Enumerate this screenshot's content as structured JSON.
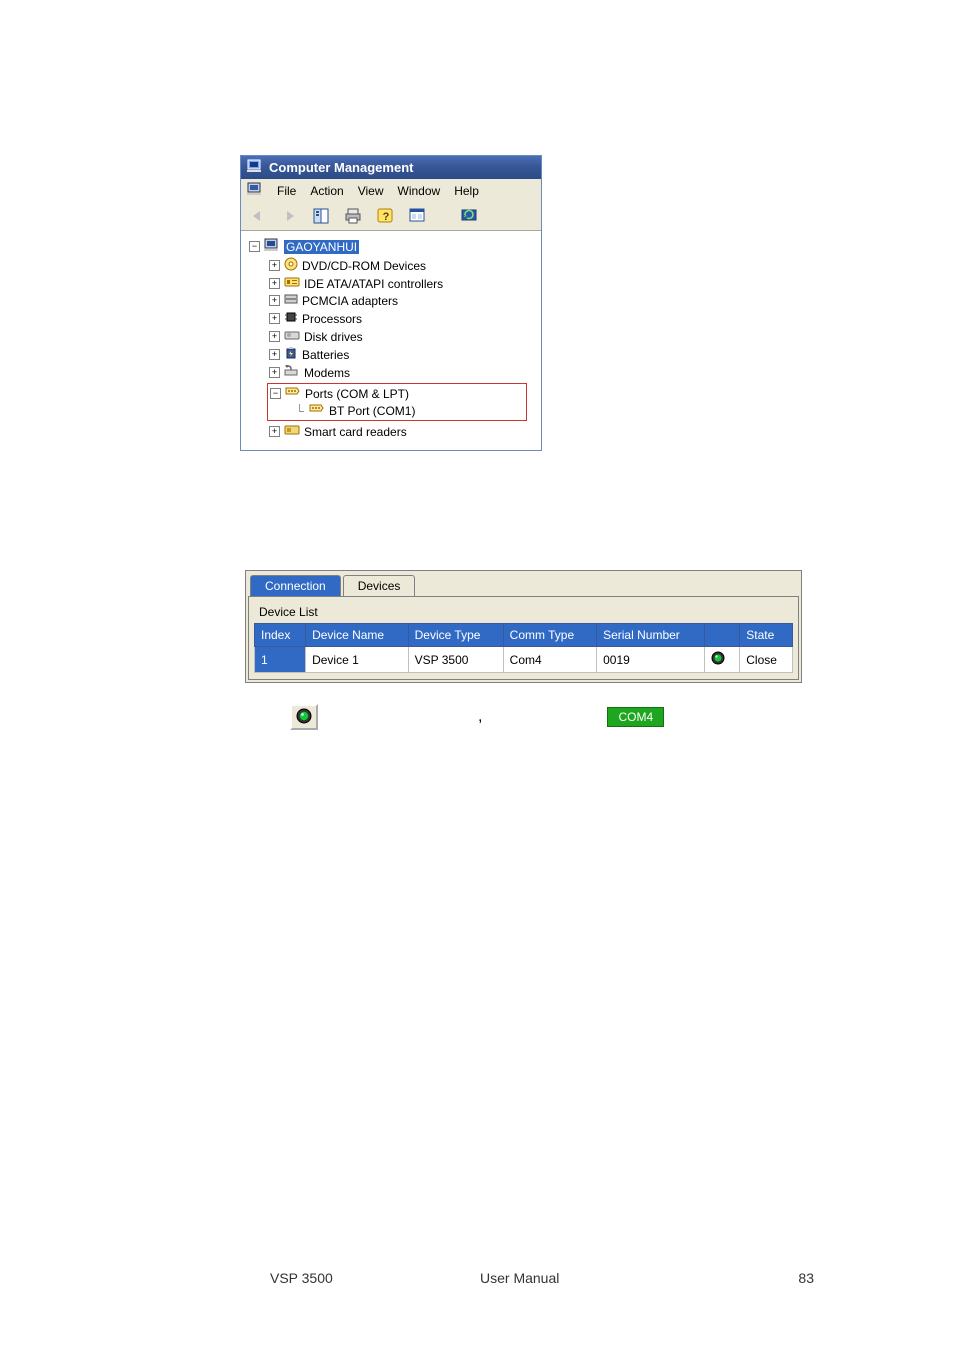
{
  "cm": {
    "title": "Computer Management",
    "menu": [
      "File",
      "Action",
      "View",
      "Window",
      "Help"
    ],
    "tree": {
      "root": "GAOYANHUI",
      "children": [
        {
          "label": "DVD/CD-ROM Devices",
          "icon": "dvd-icon"
        },
        {
          "label": "IDE ATA/ATAPI  controllers",
          "icon": "ide-icon"
        },
        {
          "label": "PCMCIA adapters",
          "icon": "pcmcia-icon"
        },
        {
          "label": "Processors",
          "icon": "cpu-icon"
        },
        {
          "label": "Disk drives",
          "icon": "disk-icon"
        },
        {
          "label": "Batteries",
          "icon": "battery-icon"
        },
        {
          "label": "Modems",
          "icon": "modem-icon"
        }
      ],
      "ports": {
        "label": "Ports (COM & LPT)",
        "child": "BT Port  (COM1)"
      },
      "last": {
        "label": "Smart card readers",
        "icon": "smartcard-icon"
      }
    }
  },
  "dev": {
    "tabs": {
      "active": "Connection",
      "inactive": "Devices"
    },
    "list_label": "Device List",
    "headers": [
      "Index",
      "Device Name",
      "Device Type",
      "Comm Type",
      "Serial Number",
      "",
      "State"
    ],
    "row": {
      "index": "1",
      "name": "Device 1",
      "type": "VSP 3500",
      "comm": "Com4",
      "serial": "0019",
      "state": "Close"
    },
    "com_badge": "COM4",
    "comma": ","
  },
  "footer": {
    "left": "VSP 3500",
    "center": "User Manual",
    "right": "83"
  }
}
